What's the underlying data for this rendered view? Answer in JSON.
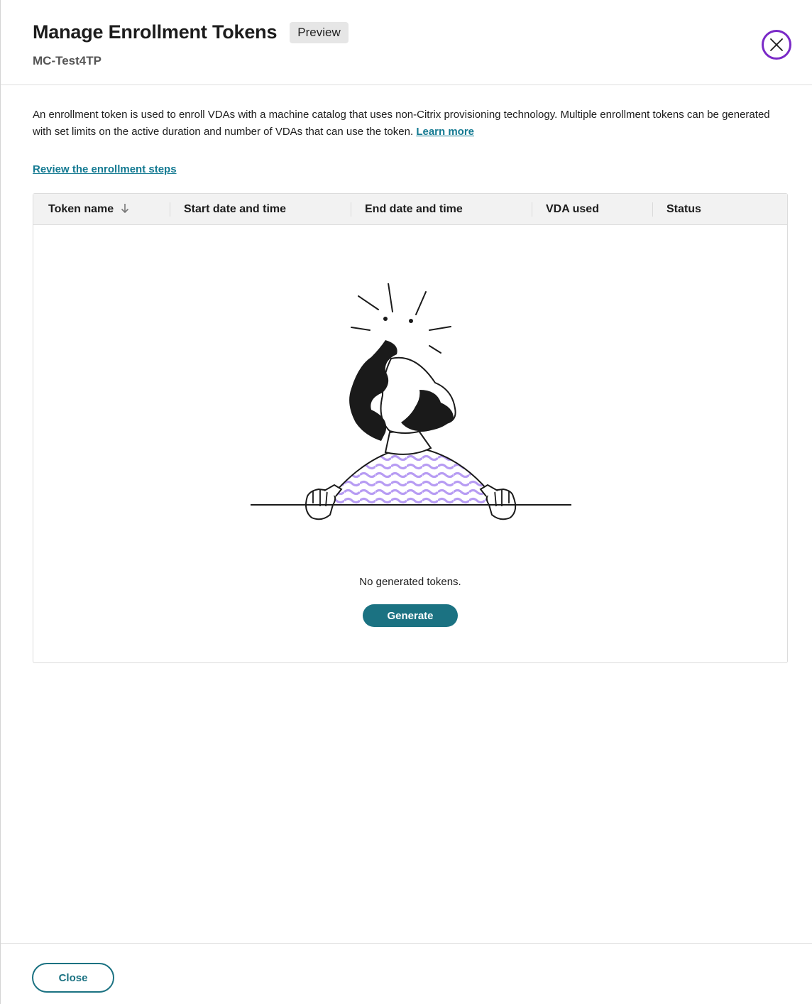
{
  "header": {
    "title": "Manage Enrollment Tokens",
    "badge": "Preview",
    "subtitle": "MC-Test4TP"
  },
  "description": {
    "text": "An enrollment token is used to enroll VDAs with a machine catalog that uses non-Citrix provisioning technology. Multiple enrollment tokens can be generated with set limits on the active duration and number of VDAs that can use the token.",
    "learn_more": "Learn more"
  },
  "review_link": "Review the enrollment steps",
  "table": {
    "columns": [
      "Token name",
      "Start date and time",
      "End date and time",
      "VDA used",
      "Status"
    ],
    "sort_column": "Token name",
    "sort_direction": "descending"
  },
  "empty_state": {
    "message": "No generated tokens.",
    "button": "Generate"
  },
  "footer": {
    "close_label": "Close"
  },
  "colors": {
    "accent": "#1b7282",
    "link": "#147a92",
    "close_icon": "#7a29c7",
    "illustration_fill": "#c9b8f5"
  },
  "icons": {
    "close": "close-circle-icon",
    "sort": "arrow-down-icon"
  }
}
